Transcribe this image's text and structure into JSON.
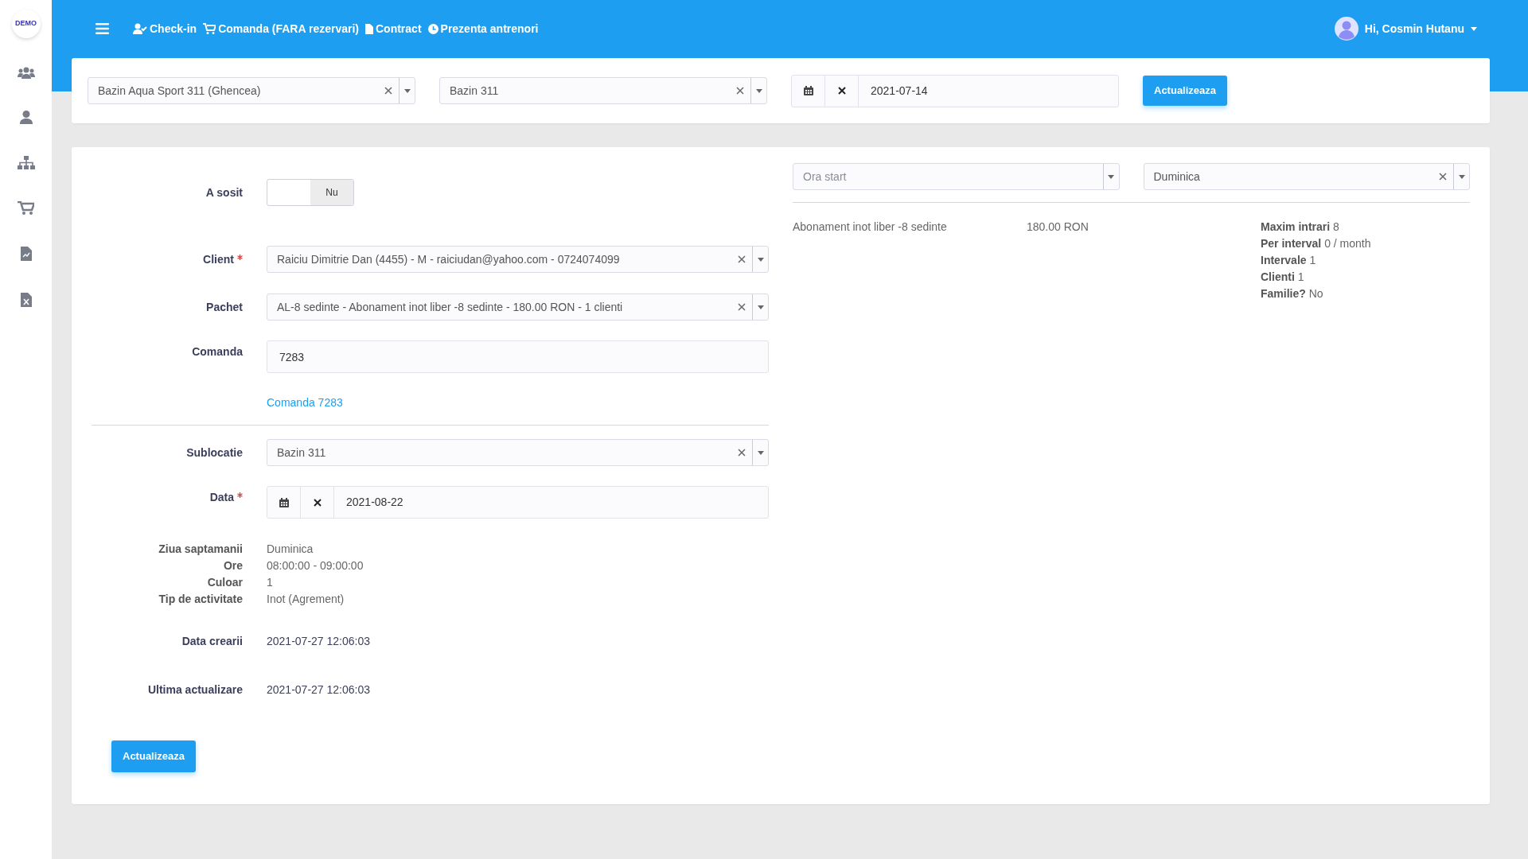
{
  "brand": {
    "logo": "DEMO"
  },
  "navbar": {
    "links": [
      {
        "label": "Check-in",
        "kind": "user-check"
      },
      {
        "label": "Comanda (FARA rezervari)",
        "kind": "cart"
      },
      {
        "label": "Contract",
        "kind": "file"
      },
      {
        "label": "Prezenta antrenori",
        "kind": "clock"
      }
    ],
    "user": "Hi, Cosmin Hutanu"
  },
  "filters": {
    "location": {
      "value": "Bazin Aqua Sport 311 (Ghencea)"
    },
    "sublocation": {
      "value": "Bazin 311"
    },
    "date": {
      "value": "2021-07-14"
    },
    "button": "Actualizeaza"
  },
  "form": {
    "fields": [
      {
        "kind": "toggle",
        "label": "A sosit",
        "required": false,
        "value": "Nu",
        "on": false
      },
      {
        "kind": "select",
        "label": "Client",
        "required": true,
        "value": "Raiciu Dimitrie Dan (4455) - M - raiciudan@yahoo.com - 0724074099"
      },
      {
        "kind": "select",
        "label": "Pachet",
        "required": false,
        "value": "AL-8 sedinte - Abonament inot liber -8 sedinte - 180.00 RON - 1 clienti"
      },
      {
        "kind": "input",
        "label": "Comanda",
        "required": false,
        "value": "7283"
      },
      {
        "kind": "link",
        "value": "Comanda 7283"
      },
      {
        "kind": "divider"
      },
      {
        "kind": "select",
        "label": "Sublocatie",
        "required": false,
        "value": "Bazin 311"
      },
      {
        "kind": "date",
        "label": "Data",
        "required": true,
        "value": "2021-08-22"
      }
    ],
    "details": [
      {
        "label": "Ziua saptamanii",
        "value": "Duminica"
      },
      {
        "label": "Ore",
        "value": "08:00:00 - 09:00:00"
      },
      {
        "label": "Culoar",
        "value": "1"
      },
      {
        "label": "Tip de activitate",
        "value": "Inot (Agrement)"
      }
    ],
    "meta": [
      {
        "label": "Data crearii",
        "value": "2021-07-27 12:06:03"
      },
      {
        "label": "Ultima actualizare",
        "value": "2021-07-27 12:06:03"
      }
    ],
    "submit": "Actualizeaza"
  },
  "side": {
    "time": {
      "placeholder": "Ora start"
    },
    "day": {
      "value": "Duminica"
    },
    "package": {
      "name": "Abonament inot liber -8 sedinte",
      "price": "180.00 RON"
    },
    "stats": [
      {
        "label": "Maxim intrari",
        "value": "8"
      },
      {
        "label": "Per interval",
        "value": "0 / month"
      },
      {
        "label": "Intervale",
        "value": "1"
      },
      {
        "label": "Clienti",
        "value": "1"
      },
      {
        "label": "Familie?",
        "value": "No"
      }
    ]
  }
}
